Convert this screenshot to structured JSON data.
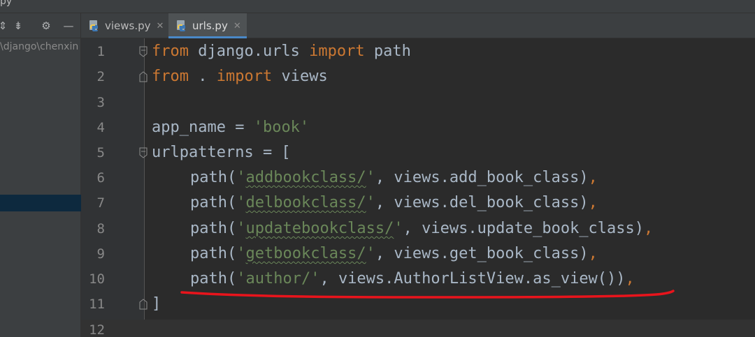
{
  "window": {
    "title": "py"
  },
  "sidebar": {
    "path_text": "\\django\\chenxin",
    "toolbar": [
      "collapse-icon",
      "settings-icon",
      "hide-icon"
    ]
  },
  "tabs": [
    {
      "label": "views.py",
      "active": false
    },
    {
      "label": "urls.py",
      "active": true
    }
  ],
  "editor": {
    "line_numbers": [
      "1",
      "2",
      "3",
      "4",
      "5",
      "6",
      "7",
      "8",
      "9",
      "10",
      "11",
      "12"
    ],
    "code": {
      "l1": {
        "kw1": "from",
        "mod": " django.urls ",
        "kw2": "import",
        "rest": " path"
      },
      "l2": {
        "kw1": "from",
        "mod": " . ",
        "kw2": "import",
        "rest": " views"
      },
      "l4": {
        "name": "app_name = ",
        "str": "'book'"
      },
      "l5": {
        "text": "urlpatterns = ["
      },
      "l6": {
        "pre": "path(",
        "q1": "'",
        "s": "addbookclass/",
        "q2": "'",
        "mid": ", views.add_book_class)",
        "end": ","
      },
      "l7": {
        "pre": "path(",
        "q1": "'",
        "s": "delbookclass/",
        "q2": "'",
        "mid": ", views.del_book_class)",
        "end": ","
      },
      "l8": {
        "pre": "path(",
        "q1": "'",
        "s": "updatebookclass/",
        "q2": "'",
        "mid": ", views.update_book_class)",
        "end": ","
      },
      "l9": {
        "pre": "path(",
        "q1": "'",
        "s": "getbookclass/",
        "q2": "'",
        "mid": ", views.get_book_class)",
        "end": ","
      },
      "l10": {
        "pre": "path(",
        "str": "'author/'",
        "mid": ", views.AuthorListView.as_view())",
        "end": ","
      },
      "l11": {
        "text": "]"
      }
    },
    "colors": {
      "keyword": "#cc7832",
      "string": "#6a8759",
      "text": "#a9b7c6",
      "annotation": "#e8141c"
    }
  }
}
